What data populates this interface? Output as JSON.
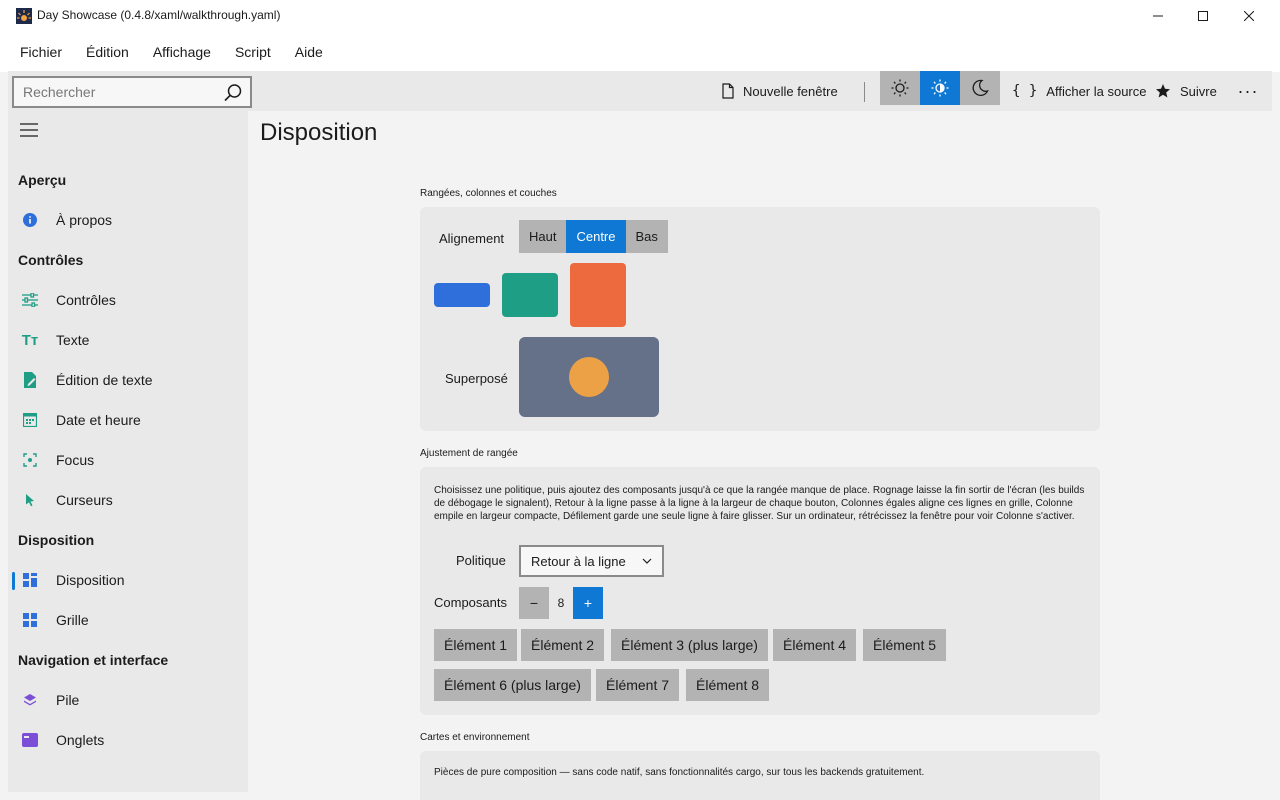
{
  "window": {
    "title": "Day Showcase (0.4.8/xaml/walkthrough.yaml)",
    "minimize": "—",
    "maximize": "☐",
    "close": "✕"
  },
  "menu": {
    "items": [
      "Fichier",
      "Édition",
      "Affichage",
      "Script",
      "Aide"
    ]
  },
  "toolbar": {
    "search_placeholder": "Rechercher",
    "new_window": "Nouvelle fenêtre",
    "view_source": "Afficher la source",
    "follow": "Suivre",
    "more": "···",
    "theme_active_index": 1
  },
  "sidebar": {
    "sections": [
      {
        "header": "Aperçu",
        "items": [
          {
            "label": "À propos",
            "icon": "info-icon"
          }
        ]
      },
      {
        "header": "Contrôles",
        "items": [
          {
            "label": "Contrôles",
            "icon": "sliders-icon"
          },
          {
            "label": "Texte",
            "icon": "text-size-icon"
          },
          {
            "label": "Édition de texte",
            "icon": "edit-document-icon"
          },
          {
            "label": "Date et heure",
            "icon": "calendar-icon"
          },
          {
            "label": "Focus",
            "icon": "focus-icon"
          },
          {
            "label": "Curseurs",
            "icon": "cursor-icon"
          }
        ]
      },
      {
        "header": "Disposition",
        "items": [
          {
            "label": "Disposition",
            "icon": "layout-grid-icon",
            "selected": true
          },
          {
            "label": "Grille",
            "icon": "grid-icon"
          }
        ]
      },
      {
        "header": "Navigation et interface",
        "items": [
          {
            "label": "Pile",
            "icon": "stack-icon"
          },
          {
            "label": "Onglets",
            "icon": "tabs-icon"
          }
        ]
      }
    ]
  },
  "main": {
    "title": "Disposition",
    "section1": {
      "title": "Rangées, colonnes et couches",
      "alignment_label": "Alignement",
      "alignment_options": [
        "Haut",
        "Centre",
        "Bas"
      ],
      "alignment_selected": "Centre",
      "overlay_label": "Superposé"
    },
    "section2": {
      "title": "Ajustement de rangée",
      "description": "Choisissez une politique, puis ajoutez des composants jusqu'à ce que la rangée manque de place. Rognage laisse la fin sortir de l'écran (les builds de débogage le signalent), Retour à la ligne passe à la ligne à la largeur de chaque bouton, Colonnes égales aligne ces lignes en grille, Colonne empile en largeur compacte, Défilement garde une seule ligne à faire glisser. Sur un ordinateur, rétrécissez la fenêtre pour voir Colonne s'activer.",
      "policy_label": "Politique",
      "policy_value": "Retour à la ligne",
      "count_label": "Composants",
      "count_minus": "−",
      "count_value": "8",
      "count_plus": "+",
      "items": [
        "Élément 1",
        "Élément 2",
        "Élément 3 (plus large)",
        "Élément 4",
        "Élément 5",
        "Élément 6 (plus large)",
        "Élément 7",
        "Élément 8"
      ]
    },
    "section3": {
      "title": "Cartes et environnement",
      "description": "Pièces de pure composition — sans code natif, sans fonctionnalités cargo, sur tous les backends gratuitement."
    }
  },
  "colors": {
    "accent": "#0f78d4",
    "block_blue": "#2f6fdb",
    "block_teal": "#1f9e86",
    "block_orange": "#ec6a3d",
    "overlay_bg": "#657189",
    "overlay_circle": "#eda147"
  }
}
